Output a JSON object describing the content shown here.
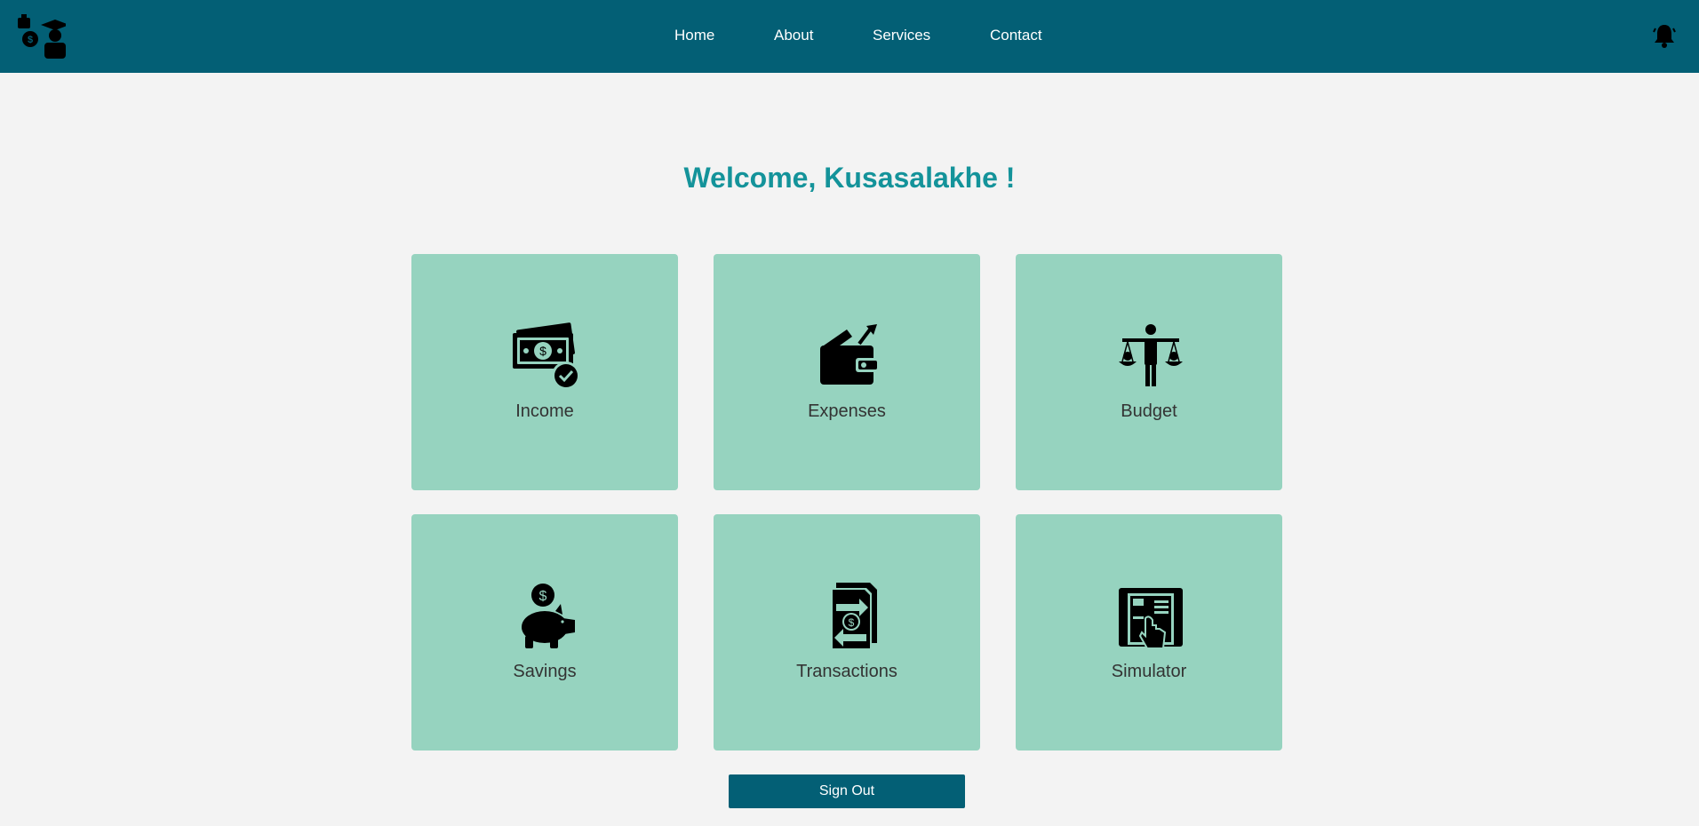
{
  "nav": {
    "links": [
      "Home",
      "About",
      "Services",
      "Contact"
    ],
    "logo_icon": "finance-people-logo-icon",
    "notification_icon": "bell-icon"
  },
  "welcome": "Welcome, Kusasalakhe !",
  "cards": [
    {
      "label": "Income",
      "icon": "money-check-icon"
    },
    {
      "label": "Expenses",
      "icon": "wallet-arrow-icon"
    },
    {
      "label": "Budget",
      "icon": "balance-person-icon"
    },
    {
      "label": "Savings",
      "icon": "piggy-bank-icon"
    },
    {
      "label": "Transactions",
      "icon": "transaction-document-icon"
    },
    {
      "label": "Simulator",
      "icon": "simulator-touch-icon"
    }
  ],
  "sign_out": "Sign Out",
  "colors": {
    "navbar": "#035f75",
    "background": "#f3f3f3",
    "welcome_text": "#14939a",
    "card": "#96d3bf",
    "button": "#035f75"
  }
}
